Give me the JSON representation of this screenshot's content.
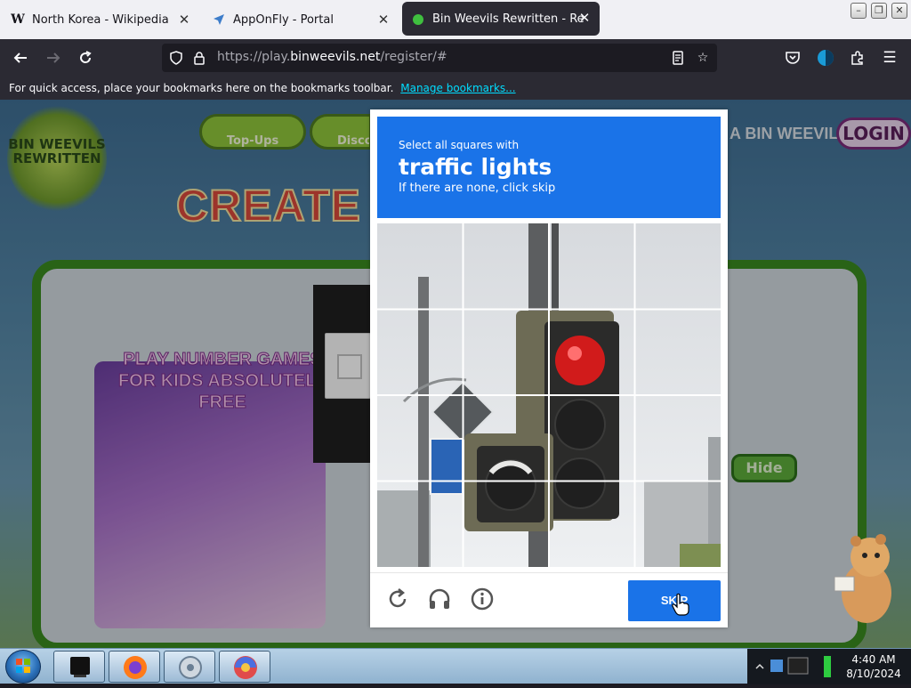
{
  "browser": {
    "tabs": [
      {
        "title": "North Korea - Wikipedia",
        "favicon": "W",
        "active": false
      },
      {
        "title": "AppOnFly - Portal",
        "active": false
      },
      {
        "title": "Bin Weevils Rewritten - Register",
        "active": true
      }
    ],
    "url_prefix": "https://play.",
    "url_domain": "binweevils.net",
    "url_path": "/register/#",
    "bookmarks_message": "For quick access, place your bookmarks here on the bookmarks toolbar.",
    "bookmarks_link": "Manage bookmarks..."
  },
  "site": {
    "logo_text": "BIN WEEVILS REWRITTEN",
    "nav_topups": "Top-Ups",
    "nav_discover": "Discov",
    "title_partial": "CREATE Y",
    "a_bin_weevil": "A BIN WEEVIL?",
    "login": "LOGIN",
    "promo_text": "PLAY NUMBER GAMES FOR KIDS ABSOLUTELY FREE",
    "hide": "Hide"
  },
  "captcha": {
    "instruction": "Select all squares with",
    "target": "traffic lights",
    "hint": "If there are none, click skip",
    "skip": "SKIP",
    "grid_rows": 4,
    "grid_cols": 4
  },
  "taskbar": {
    "time": "4:40 AM",
    "date": "8/10/2024"
  },
  "colors": {
    "captcha_blue": "#1a73e8",
    "browser_dark": "#2b2a33",
    "link": "#00ddff"
  }
}
